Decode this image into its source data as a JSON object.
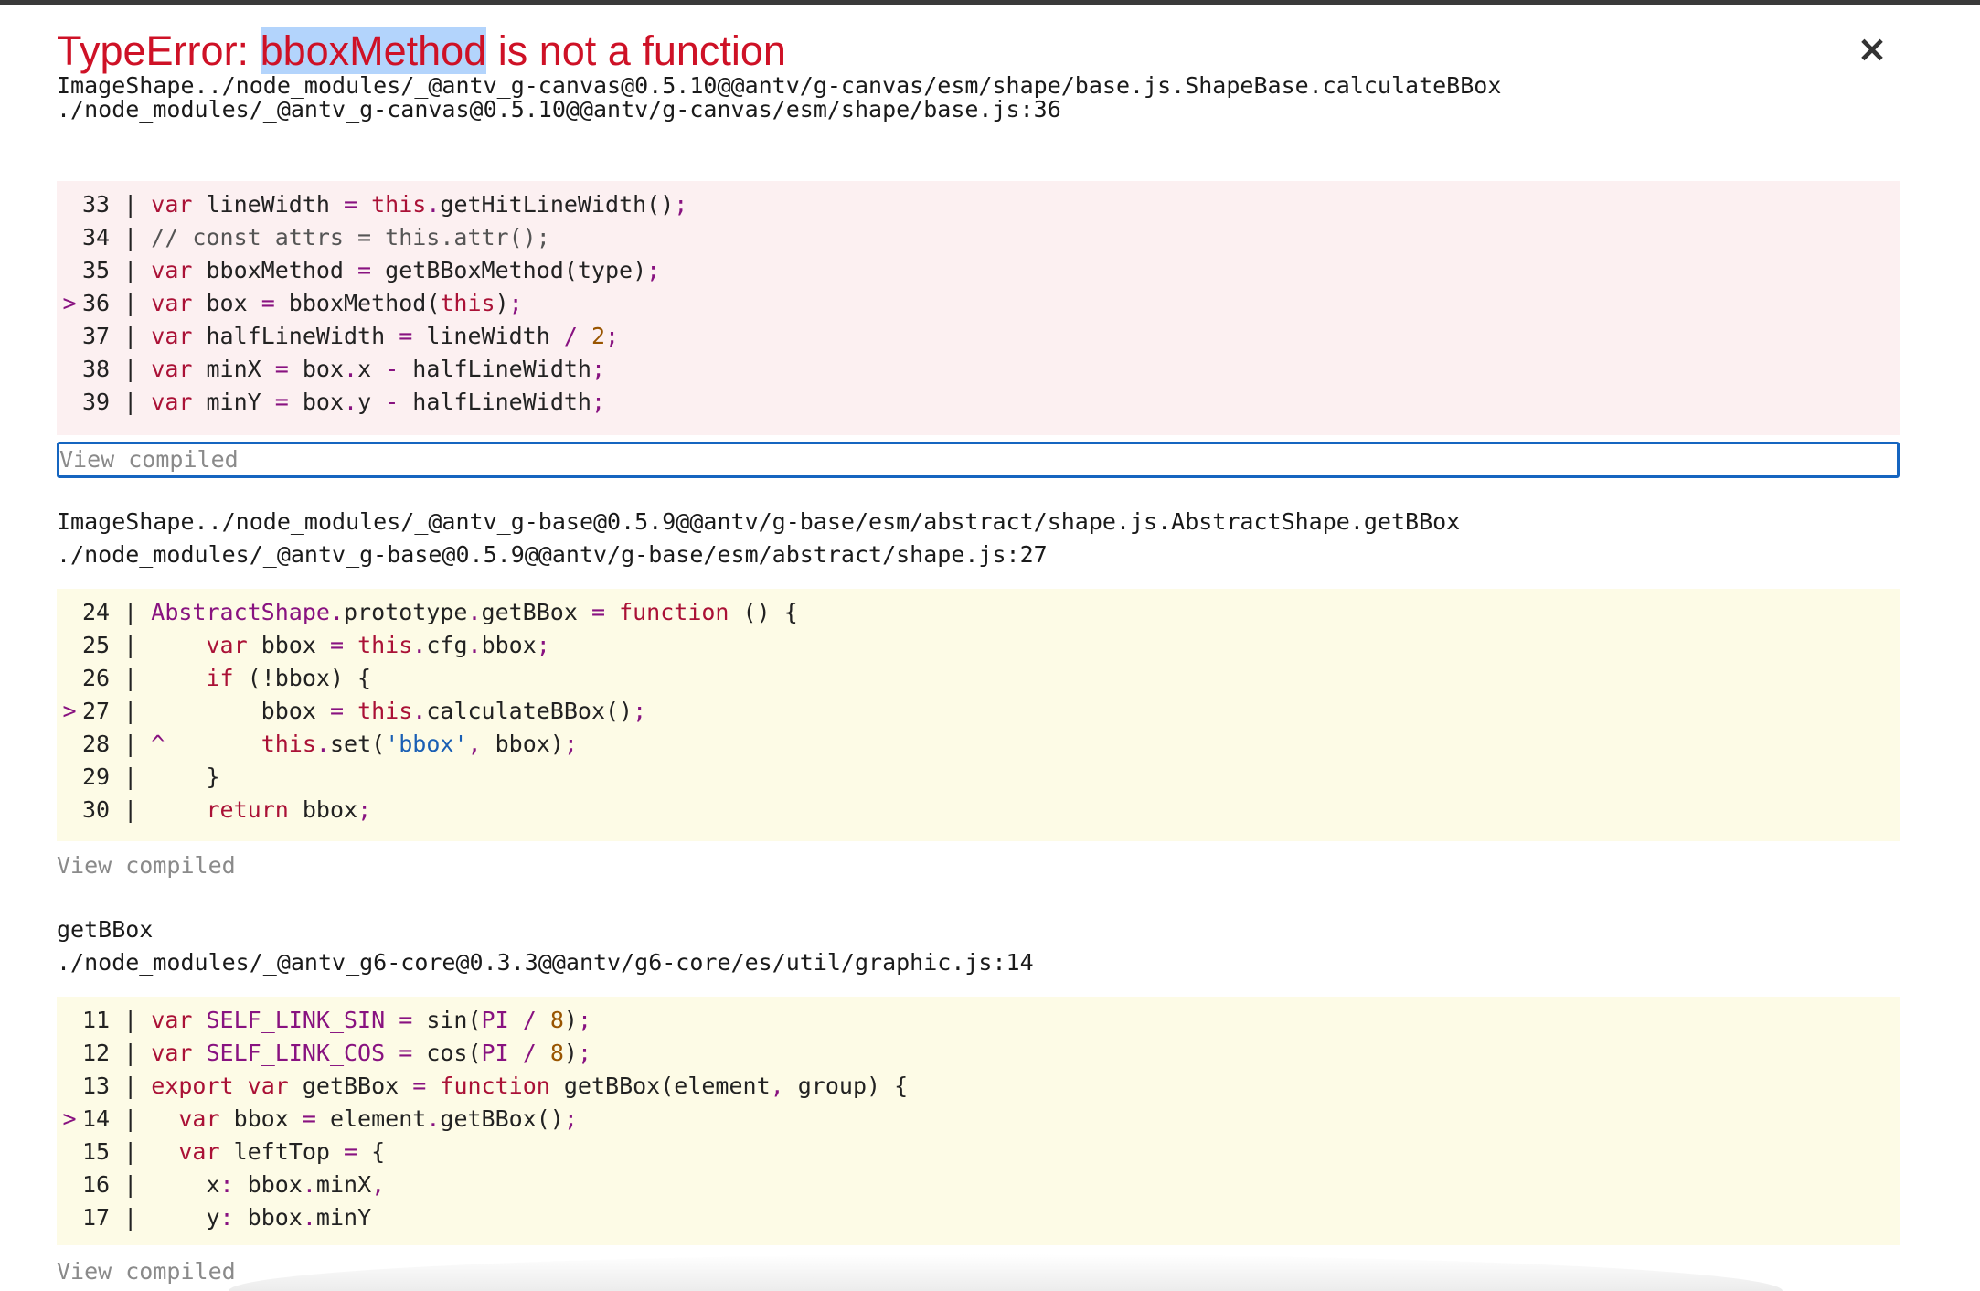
{
  "error": {
    "type_prefix": "TypeError: ",
    "highlighted": "bboxMethod",
    "message_rest": " is not a function",
    "close_glyph": "×"
  },
  "view_compiled_label": "View compiled",
  "frames": [
    {
      "function": "ImageShape../node_modules/_@antv_g-canvas@0.5.10@@antv/g-canvas/esm/shape/base.js.ShapeBase.calculateBBox",
      "location": "./node_modules/_@antv_g-canvas@0.5.10@@antv/g-canvas/esm/shape/base.js:36",
      "lines": [
        {
          "num": "33",
          "marker": " ",
          "code": "var lineWidth = this.getHitLineWidth();"
        },
        {
          "num": "34",
          "marker": " ",
          "code": "// const attrs = this.attr();"
        },
        {
          "num": "35",
          "marker": " ",
          "code": "var bboxMethod = getBBoxMethod(type);"
        },
        {
          "num": "36",
          "marker": ">",
          "code": "var box = bboxMethod(this);"
        },
        {
          "num": "37",
          "marker": " ",
          "code": "var halfLineWidth = lineWidth / 2;"
        },
        {
          "num": "38",
          "marker": " ",
          "code": "var minX = box.x - halfLineWidth;"
        },
        {
          "num": "39",
          "marker": " ",
          "code": "var minY = box.y - halfLineWidth;"
        }
      ]
    },
    {
      "function": "ImageShape../node_modules/_@antv_g-base@0.5.9@@antv/g-base/esm/abstract/shape.js.AbstractShape.getBBox",
      "location": "./node_modules/_@antv_g-base@0.5.9@@antv/g-base/esm/abstract/shape.js:27",
      "lines": [
        {
          "num": "24",
          "marker": " ",
          "code": "AbstractShape.prototype.getBBox = function () {"
        },
        {
          "num": "25",
          "marker": " ",
          "code": "    var bbox = this.cfg.bbox;"
        },
        {
          "num": "26",
          "marker": " ",
          "code": "    if (!bbox) {"
        },
        {
          "num": "27",
          "marker": ">",
          "code": "        bbox = this.calculateBBox();"
        },
        {
          "num": "28",
          "marker": " ",
          "code": "^       this.set('bbox', bbox);"
        },
        {
          "num": "29",
          "marker": " ",
          "code": "    }"
        },
        {
          "num": "30",
          "marker": " ",
          "code": "    return bbox;"
        }
      ]
    },
    {
      "function": "getBBox",
      "location": "./node_modules/_@antv_g6-core@0.3.3@@antv/g6-core/es/util/graphic.js:14",
      "lines": [
        {
          "num": "11",
          "marker": " ",
          "code": "var SELF_LINK_SIN = sin(PI / 8);"
        },
        {
          "num": "12",
          "marker": " ",
          "code": "var SELF_LINK_COS = cos(PI / 8);"
        },
        {
          "num": "13",
          "marker": " ",
          "code": "export var getBBox = function getBBox(element, group) {"
        },
        {
          "num": "14",
          "marker": ">",
          "code": "  var bbox = element.getBBox();"
        },
        {
          "num": "15",
          "marker": " ",
          "code": "  var leftTop = {"
        },
        {
          "num": "16",
          "marker": " ",
          "code": "    x: bbox.minX,"
        },
        {
          "num": "17",
          "marker": " ",
          "code": "    y: bbox.minY"
        }
      ]
    }
  ]
}
